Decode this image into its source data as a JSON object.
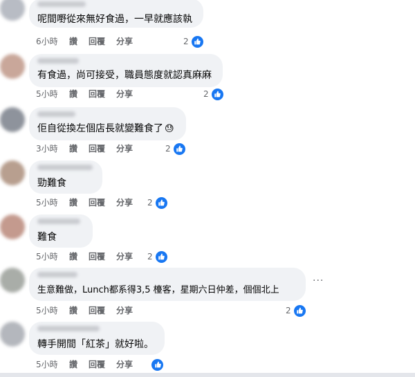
{
  "actions": {
    "like": "讚",
    "reply": "回覆",
    "share": "分享"
  },
  "more_label": "···",
  "comments": [
    {
      "text": "呢間嘢從來無好食過，一早就應該執",
      "time": "6小時",
      "reactions": "2"
    },
    {
      "text": "有食過，尚可接受，職員態度就認真麻麻",
      "time": "5小時",
      "reactions": "2"
    },
    {
      "text": "佢自從換左個店長就變難食了",
      "emoji": "😓",
      "time": "3小時",
      "reactions": "2"
    },
    {
      "text": "勁難食",
      "time": "5小時",
      "reactions": "2"
    },
    {
      "text": "難食",
      "time": "5小時",
      "reactions": "2"
    },
    {
      "text": "生意難做，Lunch都系得3,5 檯客，星期六日仲差，個個北上",
      "time": "5小時",
      "reactions": "2"
    },
    {
      "text": "轉手開間「紅茶」就好啦。",
      "time": "5小時",
      "reactions": ""
    }
  ],
  "colors": {
    "bubble": "#f0f2f5",
    "meta": "#65676b",
    "like_blue": "#1877f2"
  }
}
